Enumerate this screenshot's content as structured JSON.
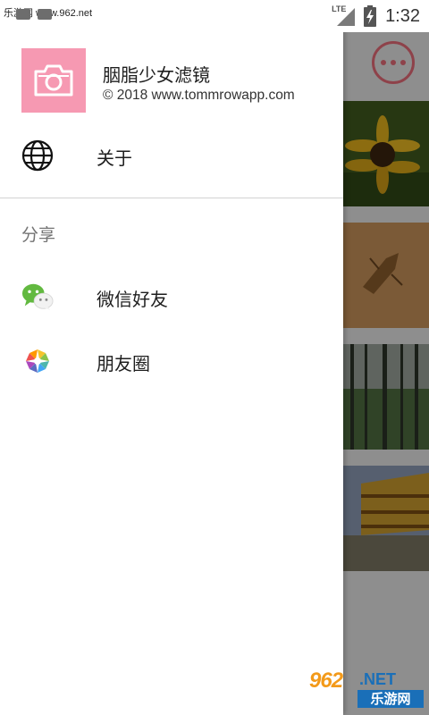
{
  "status_bar": {
    "watermark": "乐游网 www.962.net",
    "network": "LTE",
    "time": "1:32"
  },
  "drawer": {
    "header": {
      "app_name": "胭脂少女滤镜",
      "copyright": "© 2018 www.tommrowapp.com",
      "logo_icon": "camera-icon",
      "logo_color": "#f699b2"
    },
    "about_item": {
      "label": "关于",
      "icon": "globe-icon"
    },
    "share_section": {
      "title": "分享",
      "items": [
        {
          "label": "微信好友",
          "icon": "wechat-icon"
        },
        {
          "label": "朋友圈",
          "icon": "moments-icon"
        }
      ]
    }
  },
  "background": {
    "more_button_icon": "more-icon",
    "accent_color": "#e66b78"
  },
  "watermark_bottom": {
    "number": "962",
    "net": ".NET",
    "cn": "乐游网"
  }
}
